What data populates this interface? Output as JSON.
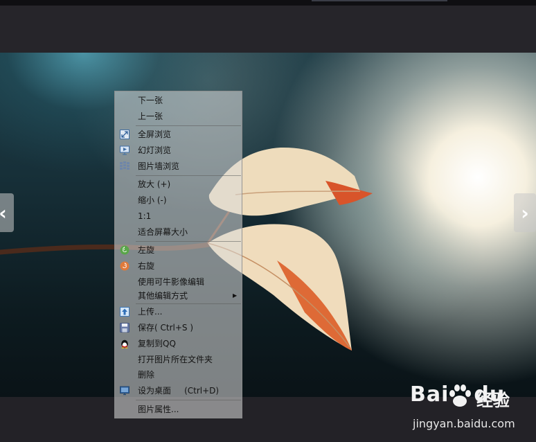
{
  "context_menu": {
    "items": [
      {
        "label": "下一张"
      },
      {
        "label": "上一张"
      },
      {
        "label": "全屏浏览",
        "icon": "fullscreen-icon"
      },
      {
        "label": "幻灯浏览",
        "icon": "slideshow-icon"
      },
      {
        "label": "图片墙浏览",
        "icon": "photo-wall-icon"
      },
      {
        "label": "放大 (+)"
      },
      {
        "label": "缩小 (-)"
      },
      {
        "label": "1:1"
      },
      {
        "label": "适合屏幕大小"
      },
      {
        "label": "左旋",
        "icon": "rotate-left-icon"
      },
      {
        "label": "右旋",
        "icon": "rotate-right-icon"
      },
      {
        "label": "使用可牛影像编辑"
      },
      {
        "label": "其他编辑方式",
        "has_submenu": true
      },
      {
        "label": "上传...",
        "icon": "upload-icon"
      },
      {
        "label": "保存( Ctrl+S )",
        "icon": "save-icon"
      },
      {
        "label": "复制到QQ",
        "icon": "qq-penguin-icon"
      },
      {
        "label": "打开图片所在文件夹"
      },
      {
        "label": "删除"
      },
      {
        "label": "设为桌面     (Ctrl+D)",
        "icon": "desktop-icon"
      },
      {
        "label": "图片属性..."
      }
    ]
  },
  "nav": {
    "prev_symbol": "‹",
    "next_symbol": "›"
  },
  "watermark": {
    "brand_bai": "Bai",
    "brand_du": "du",
    "brand_jingyan": "经验",
    "url": "jingyan.baidu.com"
  },
  "colors": {
    "background": "#232227",
    "menu_text": "#141414",
    "leaf_orange": "#e0582a"
  }
}
